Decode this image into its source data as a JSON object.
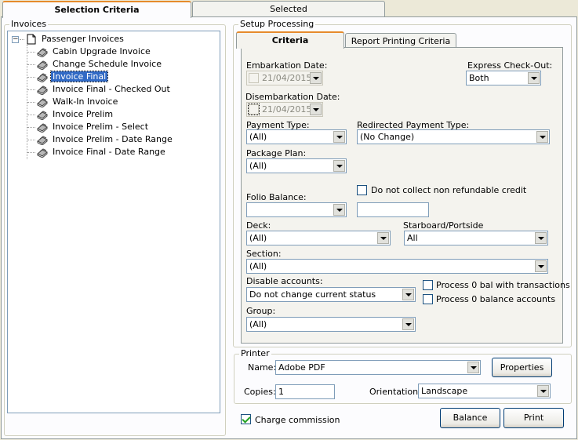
{
  "tabs": {
    "selection_criteria": "Selection Criteria",
    "selected": "Selected"
  },
  "invoices": {
    "group_title": "Invoices",
    "root": "Passenger Invoices",
    "items": [
      "Cabin Upgrade Invoice",
      "Change Schedule Invoice",
      "Invoice Final",
      "Invoice Final - Checked Out",
      "Walk-In Invoice",
      "Invoice Prelim",
      "Invoice Prelim - Select",
      "Invoice Prelim - Date Range",
      "Invoice Final - Date Range"
    ],
    "selected_index": 2
  },
  "setup": {
    "group_title": "Setup Processing",
    "tabs": {
      "criteria": "Criteria",
      "report_printing": "Report Printing Criteria"
    },
    "embarkation_label": "Embarkation Date:",
    "embarkation_value": "21/04/2015",
    "express_checkout_label": "Express Check-Out:",
    "express_checkout_value": "Both",
    "disembarkation_label": "Disembarkation Date:",
    "disembarkation_value": "21/04/2015",
    "payment_type_label": "Payment Type:",
    "payment_type_value": "(All)",
    "redirected_payment_label": "Redirected Payment Type:",
    "redirected_payment_value": "(No Change)",
    "package_plan_label": "Package Plan:",
    "package_plan_value": "(All)",
    "no_refund_credit_label": "Do not collect non refundable credit",
    "folio_balance_label": "Folio Balance:",
    "folio_balance_value": "",
    "folio_balance_amount": "",
    "deck_label": "Deck:",
    "deck_value": "(All)",
    "starboard_label": "Starboard/Portside",
    "starboard_value": "All",
    "section_label": "Section:",
    "section_value": "(All)",
    "disable_accounts_label": "Disable accounts:",
    "disable_accounts_value": "Do not change current status",
    "process_zero_tx_label": "Process 0 bal with transactions",
    "process_zero_accounts_label": "Process 0 balance accounts",
    "group_label": "Group:",
    "group_value": "(All)"
  },
  "printer": {
    "group_title": "Printer",
    "name_label": "Name:",
    "name_value": "Adobe PDF",
    "properties_button": "Properties",
    "copies_label": "Copies:",
    "copies_value": "1",
    "orientation_label": "Orientation:",
    "orientation_value": "Landscape"
  },
  "footer": {
    "charge_commission_label": "Charge commission",
    "charge_commission_checked": true,
    "balance_button": "Balance",
    "print_button": "Print"
  }
}
